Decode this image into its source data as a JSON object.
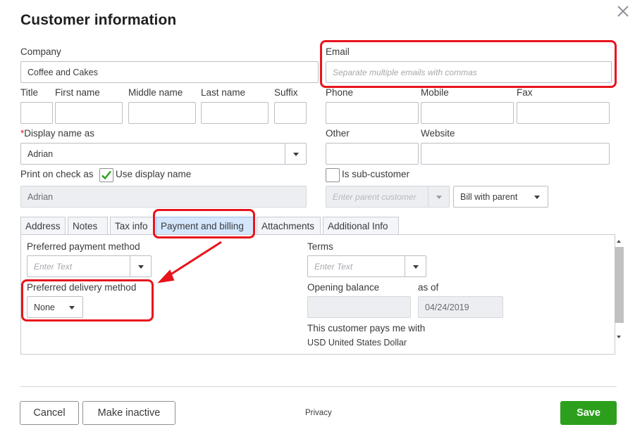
{
  "dialog": {
    "title": "Customer information",
    "close_label": "×"
  },
  "form": {
    "company": {
      "label": "Company",
      "value": "Coffee and Cakes"
    },
    "email": {
      "label": "Email",
      "placeholder": "Separate multiple emails with commas"
    },
    "title": {
      "label": "Title",
      "value": ""
    },
    "first_name": {
      "label": "First name",
      "value": ""
    },
    "middle_name": {
      "label": "Middle name",
      "value": ""
    },
    "last_name": {
      "label": "Last name",
      "value": ""
    },
    "suffix": {
      "label": "Suffix",
      "value": ""
    },
    "phone": {
      "label": "Phone",
      "value": ""
    },
    "mobile": {
      "label": "Mobile",
      "value": ""
    },
    "fax": {
      "label": "Fax",
      "value": ""
    },
    "display_name": {
      "required_mark": "*",
      "label": "Display name as",
      "value": "Adrian"
    },
    "other": {
      "label": "Other",
      "value": ""
    },
    "website": {
      "label": "Website",
      "value": ""
    },
    "print_on_check": {
      "label": "Print on check as",
      "checkbox_label": "Use display name",
      "checked": true,
      "value": "Adrian"
    },
    "sub_customer": {
      "label": "Is sub-customer",
      "checked": false,
      "parent_placeholder": "Enter parent customer",
      "bill_with": "Bill with parent"
    }
  },
  "tabs": [
    {
      "label": "Address",
      "active": false
    },
    {
      "label": "Notes",
      "active": false
    },
    {
      "label": "Tax info",
      "active": false
    },
    {
      "label": "Payment and billing",
      "active": true
    },
    {
      "label": "Attachments",
      "active": false
    },
    {
      "label": "Additional Info",
      "active": false
    }
  ],
  "payment_billing": {
    "preferred_payment_method": {
      "label": "Preferred payment method",
      "placeholder": "Enter Text"
    },
    "preferred_delivery_method": {
      "label": "Preferred delivery method",
      "value": "None"
    },
    "terms": {
      "label": "Terms",
      "placeholder": "Enter Text"
    },
    "opening_balance": {
      "label": "Opening balance",
      "value": ""
    },
    "as_of": {
      "label": "as of",
      "value": "04/24/2019"
    },
    "pays_with": {
      "label": "This customer pays me with",
      "value": "USD United States Dollar"
    }
  },
  "footer": {
    "cancel": "Cancel",
    "make_inactive": "Make inactive",
    "privacy": "Privacy",
    "save": "Save"
  },
  "colors": {
    "annotation": "#e8141c",
    "save_green": "#2ca01c",
    "active_tab": "#d4e6fb",
    "checkmark": "#2ca01c"
  }
}
